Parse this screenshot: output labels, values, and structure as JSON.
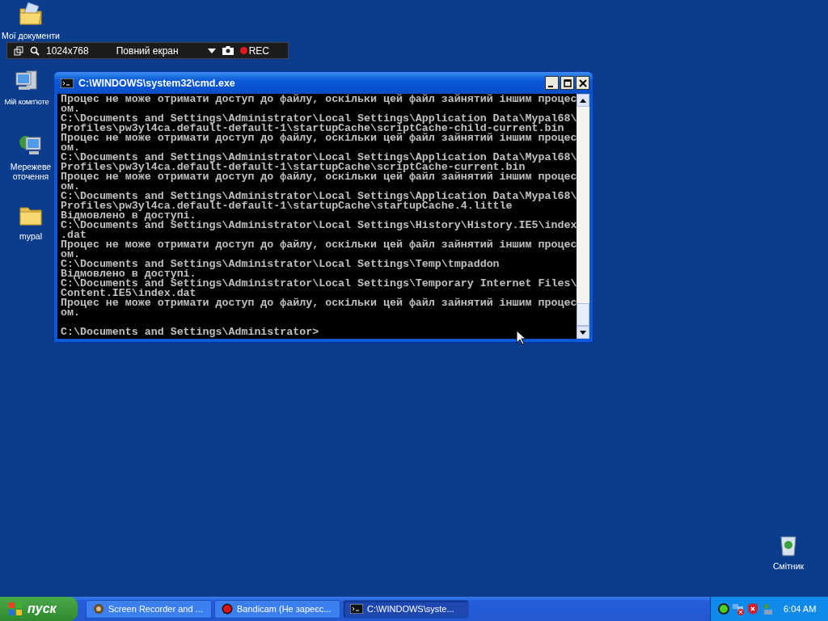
{
  "desktop_icons": [
    {
      "kind": "documents",
      "label": "Мої документи"
    },
    {
      "kind": "computer",
      "label": "Мій комп'юте"
    },
    {
      "kind": "network",
      "label": "Мережеве оточення"
    },
    {
      "kind": "folder",
      "label": "mypal"
    }
  ],
  "recycle_bin": {
    "label": "Смітник"
  },
  "recorder_bar": {
    "resolution": "1024x768",
    "mode": "Повний екран",
    "rec": "REC"
  },
  "window": {
    "title": "C:\\WINDOWS\\system32\\cmd.exe",
    "lines": [
      "Процес не може отримати доступ до файлу, оскільки цей файл зайнятий іншим процес",
      "ом.",
      "C:\\Documents and Settings\\Administrator\\Local Settings\\Application Data\\Mypal68\\",
      "Profiles\\pw3yl4ca.default-default-1\\startupCache\\scriptCache-child-current.bin",
      "Процес не може отримати доступ до файлу, оскільки цей файл зайнятий іншим процес",
      "ом.",
      "C:\\Documents and Settings\\Administrator\\Local Settings\\Application Data\\Mypal68\\",
      "Profiles\\pw3yl4ca.default-default-1\\startupCache\\scriptCache-current.bin",
      "Процес не може отримати доступ до файлу, оскільки цей файл зайнятий іншим процес",
      "ом.",
      "C:\\Documents and Settings\\Administrator\\Local Settings\\Application Data\\Mypal68\\",
      "Profiles\\pw3yl4ca.default-default-1\\startupCache\\startupCache.4.little",
      "Відмовлено в доступі.",
      "C:\\Documents and Settings\\Administrator\\Local Settings\\History\\History.IE5\\index",
      ".dat",
      "Процес не може отримати доступ до файлу, оскільки цей файл зайнятий іншим процес",
      "ом.",
      "C:\\Documents and Settings\\Administrator\\Local Settings\\Temp\\tmpaddon",
      "Відмовлено в доступі.",
      "C:\\Documents and Settings\\Administrator\\Local Settings\\Temporary Internet Files\\",
      "Content.IE5\\index.dat",
      "Процес не може отримати доступ до файлу, оскільки цей файл зайнятий іншим процес",
      "ом."
    ],
    "prompt": "C:\\Documents and Settings\\Administrator>"
  },
  "taskbar": {
    "start": "пуск",
    "tasks": [
      {
        "kind": "recorder",
        "label": "Screen Recorder and ...",
        "selected": false
      },
      {
        "kind": "bandicam",
        "label": "Bandicam (Не зареєс...",
        "selected": false
      },
      {
        "kind": "console",
        "label": "C:\\WINDOWS\\syste...",
        "selected": true
      }
    ],
    "clock": "6:04 AM"
  }
}
